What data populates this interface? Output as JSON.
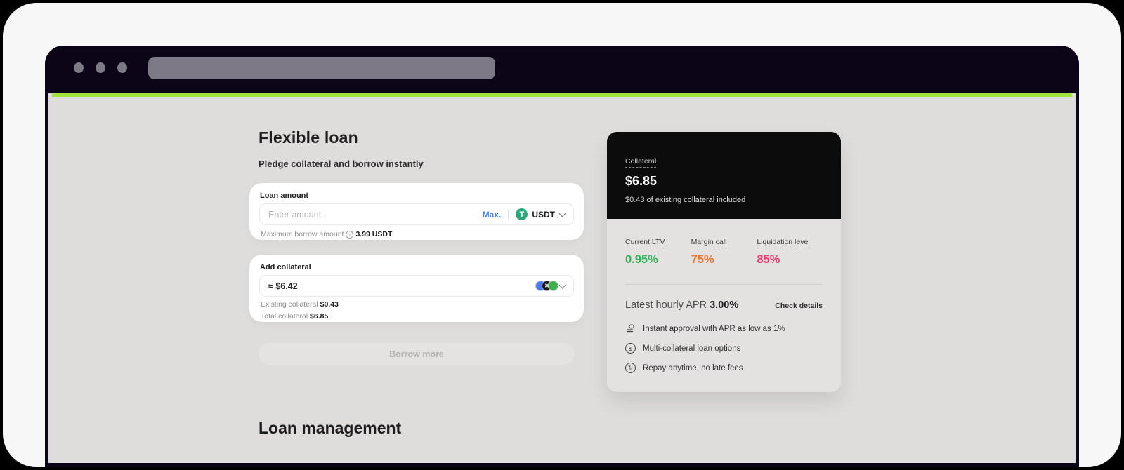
{
  "colors": {
    "accent_line": "#a0e23c",
    "titlebar": "#0b0517",
    "content_bg": "#dedddc",
    "max_link_blue": "#3f7df2",
    "tether_green": "#2ea57b",
    "ltv_green": "#2fb457",
    "margin_orange": "#f0762b",
    "liquidation_pink": "#e63e74"
  },
  "page": {
    "title": "Flexible loan",
    "subtitle": "Pledge collateral and borrow instantly",
    "section2_title": "Loan management"
  },
  "loan_amount": {
    "label": "Loan amount",
    "placeholder": "Enter amount",
    "max_label": "Max.",
    "currency": "USDT",
    "currency_symbol": "T",
    "helper_label": "Maximum borrow amount",
    "helper_value": "3.99 USDT"
  },
  "add_collateral": {
    "label": "Add collateral",
    "value": "≈ $6.42",
    "existing_label": "Existing collateral",
    "existing_value": "$0.43",
    "total_label": "Total collateral",
    "total_value": "$6.85"
  },
  "borrow_button": "Borrow more",
  "summary": {
    "collateral_label": "Collateral",
    "collateral_value": "$6.85",
    "collateral_note": "$0.43 of existing collateral included",
    "stats": [
      {
        "label": "Current LTV",
        "value": "0.95%",
        "color": "#2fb457"
      },
      {
        "label": "Margin call",
        "value": "75%",
        "color": "#f0762b"
      },
      {
        "label": "Liquidation level",
        "value": "85%",
        "color": "#e63e74"
      }
    ],
    "apr_label": "Latest hourly APR",
    "apr_value": "3.00%",
    "check_details": "Check details",
    "benefits": [
      {
        "icon": "$",
        "text": "Instant approval with APR as low as 1%"
      },
      {
        "icon": "$",
        "text": "Multi-collateral loan options"
      },
      {
        "icon": "↻",
        "text": "Repay anytime, no late fees"
      }
    ]
  }
}
